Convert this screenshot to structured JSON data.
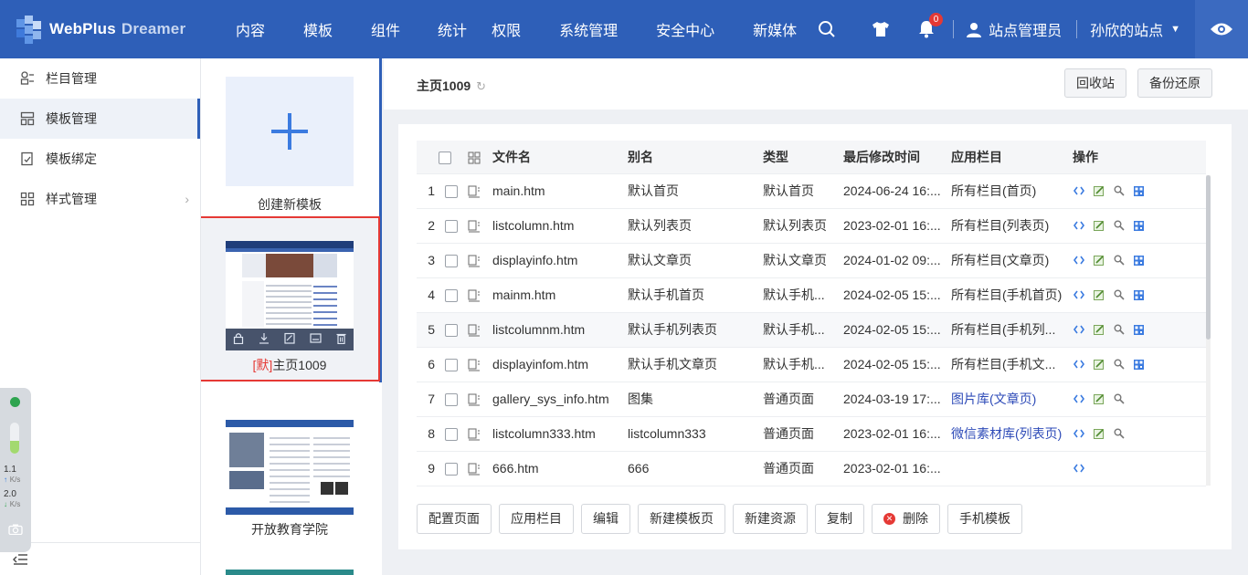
{
  "brand": {
    "name": "WebPlus",
    "product": "Dreamer"
  },
  "nav": [
    "内容",
    "模板",
    "组件",
    "统计",
    "权限",
    "系统管理",
    "安全中心",
    "新媒体"
  ],
  "header": {
    "notification_count": "0",
    "user_role": "站点管理员",
    "site_name": "孙欣的站点"
  },
  "sidebar": {
    "items": [
      {
        "label": "栏目管理",
        "icon": "column-icon"
      },
      {
        "label": "模板管理",
        "icon": "template-icon",
        "active": true
      },
      {
        "label": "模板绑定",
        "icon": "bind-icon"
      },
      {
        "label": "样式管理",
        "icon": "style-icon"
      }
    ]
  },
  "widget": {
    "up": "1.1",
    "up_unit": "K/s",
    "down": "2.0",
    "down_unit": "K/s"
  },
  "templates": {
    "new_label": "创建新模板",
    "selected": {
      "default_tag": "[默]",
      "label": "主页1009"
    },
    "second": {
      "label": "开放教育学院"
    }
  },
  "main": {
    "title": "主页1009",
    "recycle_label": "回收站",
    "backup_label": "备份还原",
    "table": {
      "headers": [
        "文件名",
        "别名",
        "类型",
        "最后修改时间",
        "应用栏目",
        "操作"
      ],
      "rows": [
        {
          "n": "1",
          "file": "main.htm",
          "alias": "默认首页",
          "type": "默认首页",
          "time": "2024-06-24 16:...",
          "column": "所有栏目(首页)",
          "link": false,
          "ops": 4
        },
        {
          "n": "2",
          "file": "listcolumn.htm",
          "alias": "默认列表页",
          "type": "默认列表页",
          "time": "2023-02-01 16:...",
          "column": "所有栏目(列表页)",
          "link": false,
          "ops": 4
        },
        {
          "n": "3",
          "file": "displayinfo.htm",
          "alias": "默认文章页",
          "type": "默认文章页",
          "time": "2024-01-02 09:...",
          "column": "所有栏目(文章页)",
          "link": false,
          "ops": 4
        },
        {
          "n": "4",
          "file": "mainm.htm",
          "alias": "默认手机首页",
          "type": "默认手机...",
          "time": "2024-02-05 15:...",
          "column": "所有栏目(手机首页)",
          "link": false,
          "ops": 4
        },
        {
          "n": "5",
          "file": "listcolumnm.htm",
          "alias": "默认手机列表页",
          "type": "默认手机...",
          "time": "2024-02-05 15:...",
          "column": "所有栏目(手机列...",
          "link": false,
          "ops": 4
        },
        {
          "n": "6",
          "file": "displayinfom.htm",
          "alias": "默认手机文章页",
          "type": "默认手机...",
          "time": "2024-02-05 15:...",
          "column": "所有栏目(手机文...",
          "link": false,
          "ops": 4
        },
        {
          "n": "7",
          "file": "gallery_sys_info.htm",
          "alias": "图集",
          "type": "普通页面",
          "time": "2024-03-19 17:...",
          "column": "图片库(文章页)",
          "link": true,
          "ops": 3
        },
        {
          "n": "8",
          "file": "listcolumn333.htm",
          "alias": "listcolumn333",
          "type": "普通页面",
          "time": "2023-02-01 16:...",
          "column": "微信素材库(列表页)",
          "link": true,
          "ops": 3
        },
        {
          "n": "9",
          "file": "666.htm",
          "alias": "666",
          "type": "普通页面",
          "time": "2023-02-01 16:...",
          "column": "",
          "link": false,
          "ops": 1
        }
      ]
    },
    "actions": [
      "配置页面",
      "应用栏目",
      "编辑",
      "新建模板页",
      "新建资源",
      "复制",
      "删除",
      "手机模板"
    ]
  },
  "colors": {
    "topbar": "#2e5fb8",
    "selected_border": "#e53935",
    "link": "#2e4bb8"
  }
}
